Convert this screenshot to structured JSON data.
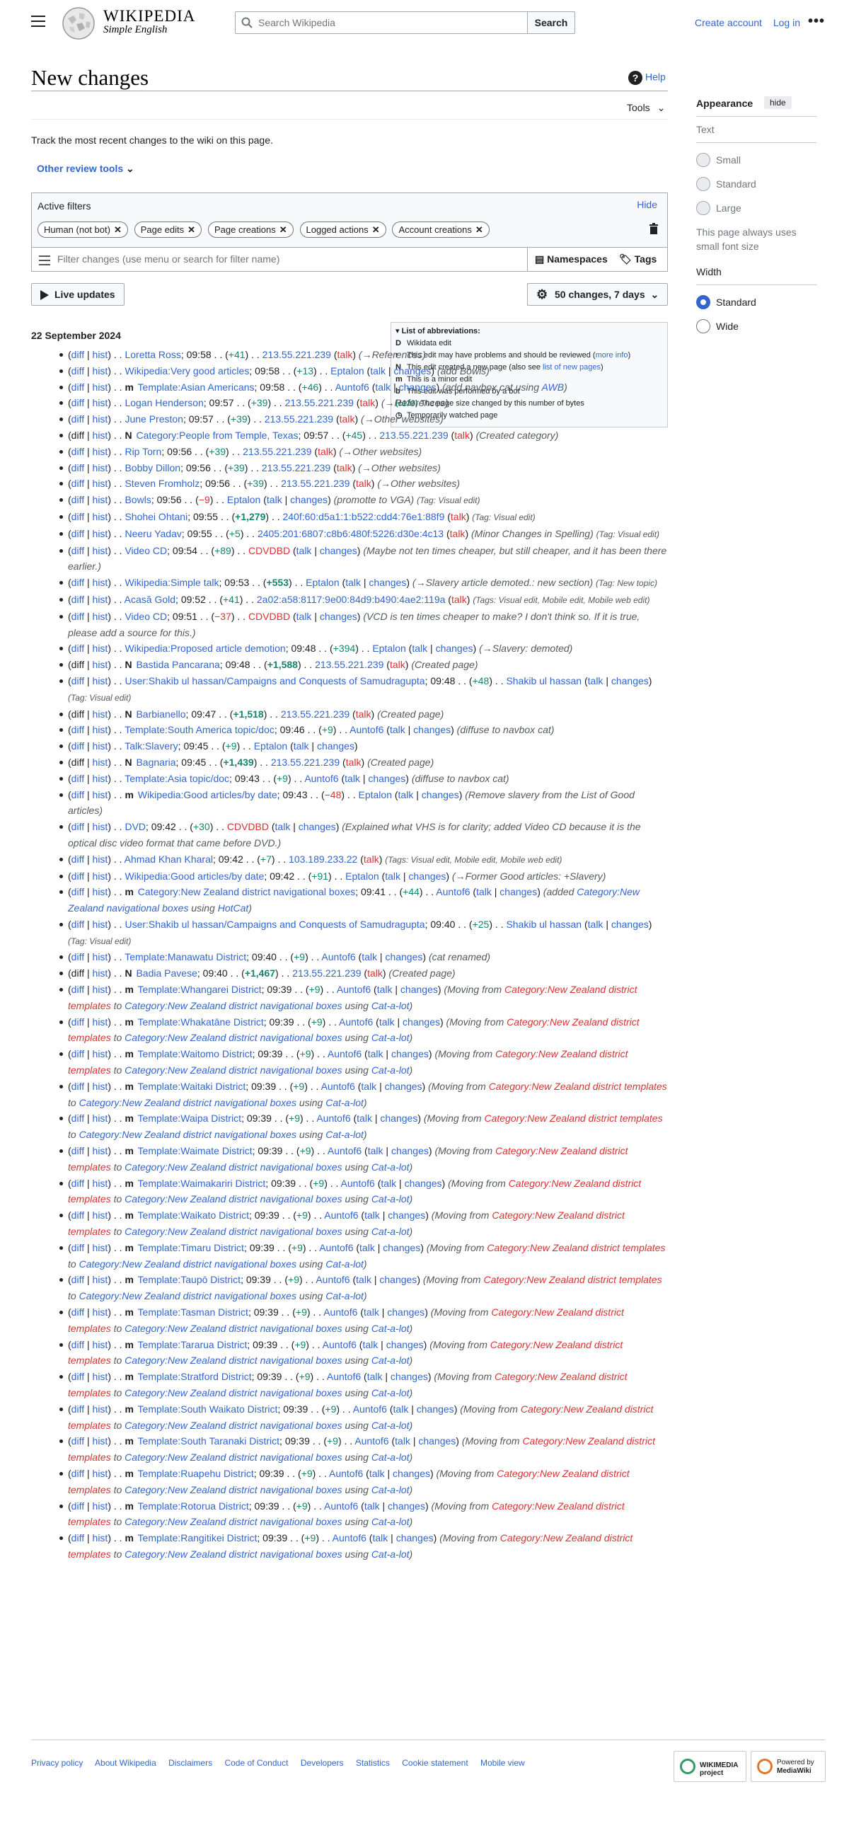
{
  "header": {
    "wordmark_line1": "WIKIPEDIA",
    "wordmark_line2": "Simple English",
    "search_placeholder": "Search Wikipedia",
    "search_button": "Search",
    "create_account": "Create account",
    "log_in": "Log in",
    "more": "•••"
  },
  "page": {
    "title": "New changes",
    "help": "Help",
    "tools": "Tools",
    "intro": "Track the most recent changes to the wiki on this page.",
    "other_review_tools": "Other review tools"
  },
  "filters": {
    "active_label": "Active filters",
    "hide": "Hide",
    "chips": [
      "Human (not bot)",
      "Page edits",
      "Page creations",
      "Logged actions",
      "Account creations"
    ],
    "input_placeholder": "Filter changes (use menu or search for filter name)",
    "namespaces": "Namespaces",
    "tags": "Tags"
  },
  "controls": {
    "live_updates": "Live updates",
    "changes_range": "50 changes, 7 days"
  },
  "legend": {
    "title": "List of abbreviations:",
    "items": [
      {
        "key": "D",
        "text": "Wikidata edit"
      },
      {
        "key": "r",
        "text": "This edit may have problems and should be reviewed",
        "link": "more info"
      },
      {
        "key": "N",
        "text": "This edit created a new page (also see",
        "link": "list of new pages",
        "after": ")"
      },
      {
        "key": "m",
        "text": "This is a minor edit"
      },
      {
        "key": "b",
        "text": "This edit was performed by a bot"
      },
      {
        "key": "(±123)",
        "text": "The page size changed by this number of bytes"
      },
      {
        "key": "◷",
        "text": "Temporarily watched page"
      }
    ]
  },
  "date_heading": "22 September 2024",
  "changes": [
    {
      "diff": true,
      "flag": "",
      "title": "Loretta Ross",
      "time": "09:58",
      "size": "+41",
      "user": "213.55.221.239",
      "user_red": false,
      "ip": true,
      "comment": "(→References)"
    },
    {
      "diff": true,
      "flag": "",
      "title": "Wikipedia:Very good articles",
      "time": "09:58",
      "size": "+13",
      "user": "Eptalon",
      "ip": false,
      "comment": "(add Bowls)"
    },
    {
      "diff": true,
      "flag": "m",
      "title": "Template:Asian Americans",
      "time": "09:58",
      "size": "+46",
      "user": "Auntof6",
      "ip": false,
      "comment": "(add navbox cat using ",
      "comment_link": "AWB",
      "comment_after": ")"
    },
    {
      "diff": true,
      "flag": "",
      "title": "Logan Henderson",
      "time": "09:57",
      "size": "+39",
      "user": "213.55.221.239",
      "ip": true,
      "comment": "(→References)"
    },
    {
      "diff": true,
      "flag": "",
      "title": "June Preston",
      "time": "09:57",
      "size": "+39",
      "user": "213.55.221.239",
      "ip": true,
      "comment": "(→Other websites)"
    },
    {
      "diff": false,
      "flag": "N",
      "title": "Category:People from Temple, Texas",
      "time": "09:57",
      "size": "+45",
      "user": "213.55.221.239",
      "ip": true,
      "comment": "(Created category)"
    },
    {
      "diff": true,
      "flag": "",
      "title": "Rip Torn",
      "time": "09:56",
      "size": "+39",
      "user": "213.55.221.239",
      "ip": true,
      "comment": "(→Other websites)"
    },
    {
      "diff": true,
      "flag": "",
      "title": "Bobby Dillon",
      "time": "09:56",
      "size": "+39",
      "user": "213.55.221.239",
      "ip": true,
      "comment": "(→Other websites)"
    },
    {
      "diff": true,
      "flag": "",
      "title": "Steven Fromholz",
      "time": "09:56",
      "size": "+39",
      "user": "213.55.221.239",
      "ip": true,
      "comment": "(→Other websites)"
    },
    {
      "diff": true,
      "flag": "",
      "title": "Bowls",
      "time": "09:56",
      "size": "−9",
      "neg": true,
      "user": "Eptalon",
      "ip": false,
      "comment": "(promotte to VGA)",
      "tag": "(Tag: Visual edit)"
    },
    {
      "diff": true,
      "flag": "",
      "title": "Shohei Ohtani",
      "time": "09:55",
      "size": "+1,279",
      "big": true,
      "user": "240f:60:d5a1:1:b522:cdd4:76e1:88f9",
      "ip": true,
      "comment": "",
      "tag": "(Tag: Visual edit)"
    },
    {
      "diff": true,
      "flag": "",
      "title": "Neeru Yadav",
      "time": "09:55",
      "size": "+5",
      "user": "2405:201:6807:c8b6:480f:5226:d30e:4c13",
      "ip": true,
      "comment": "(Minor Changes in Spelling)",
      "tag": "(Tag: Visual edit)"
    },
    {
      "diff": true,
      "flag": "",
      "title": "Video CD",
      "time": "09:54",
      "size": "+89",
      "user": "CDVDBD",
      "user_red": true,
      "ip": false,
      "comment": "(Maybe not ten times cheaper, but still cheaper, and it has been there earlier.)"
    },
    {
      "diff": true,
      "flag": "",
      "title": "Wikipedia:Simple talk",
      "time": "09:53",
      "size": "+553",
      "big": true,
      "user": "Eptalon",
      "ip": false,
      "comment": "(→Slavery article demoted.: new section)",
      "tag": "(Tag: New topic)"
    },
    {
      "diff": true,
      "flag": "",
      "title": "Acasă Gold",
      "time": "09:52",
      "size": "+41",
      "user": "2a02:a58:8117:9e00:84d9:b490:4ae2:119a",
      "ip": true,
      "comment": "",
      "tag": "(Tags: Visual edit, Mobile edit, Mobile web edit)"
    },
    {
      "diff": true,
      "flag": "",
      "title": "Video CD",
      "time": "09:51",
      "size": "−37",
      "neg": true,
      "user": "CDVDBD",
      "user_red": true,
      "ip": false,
      "comment": "(VCD is ten times cheaper to make? I don't think so. If it is true, please add a source for this.)"
    },
    {
      "diff": true,
      "flag": "",
      "title": "Wikipedia:Proposed article demotion",
      "time": "09:48",
      "size": "+394",
      "user": "Eptalon",
      "ip": false,
      "comment": "(→Slavery: demoted)"
    },
    {
      "diff": false,
      "flag": "N",
      "title": "Bastida Pancarana",
      "time": "09:48",
      "size": "+1,588",
      "big": true,
      "user": "213.55.221.239",
      "ip": true,
      "comment": "(Created page)"
    },
    {
      "diff": true,
      "flag": "",
      "title": "User:Shakib ul hassan/Campaigns and Conquests of Samudragupta",
      "time": "09:48",
      "size": "+48",
      "user": "Shakib ul hassan",
      "ip": false,
      "comment": "",
      "tag": "(Tag: Visual edit)"
    },
    {
      "diff": false,
      "flag": "N",
      "title": "Barbianello",
      "time": "09:47",
      "size": "+1,518",
      "big": true,
      "user": "213.55.221.239",
      "ip": true,
      "comment": "(Created page)"
    },
    {
      "diff": true,
      "flag": "",
      "title": "Template:South America topic/doc",
      "time": "09:46",
      "size": "+9",
      "user": "Auntof6",
      "ip": false,
      "comment": "(diffuse to navbox cat)"
    },
    {
      "diff": true,
      "flag": "",
      "title": "Talk:Slavery",
      "time": "09:45",
      "size": "+9",
      "user": "Eptalon",
      "ip": false,
      "comment": ""
    },
    {
      "diff": false,
      "flag": "N",
      "title": "Bagnaria",
      "time": "09:45",
      "size": "+1,439",
      "big": true,
      "user": "213.55.221.239",
      "ip": true,
      "comment": "(Created page)"
    },
    {
      "diff": true,
      "flag": "",
      "title": "Template:Asia topic/doc",
      "time": "09:43",
      "size": "+9",
      "user": "Auntof6",
      "ip": false,
      "comment": "(diffuse to navbox cat)"
    },
    {
      "diff": true,
      "flag": "m",
      "title": "Wikipedia:Good articles/by date",
      "time": "09:43",
      "size": "−48",
      "neg": true,
      "user": "Eptalon",
      "ip": false,
      "comment": "(Remove slavery from the List of Good articles)"
    },
    {
      "diff": true,
      "flag": "",
      "title": "DVD",
      "time": "09:42",
      "size": "+30",
      "user": "CDVDBD",
      "user_red": true,
      "ip": false,
      "comment": "(Explained what VHS is for clarity; added Video CD because it is the optical disc video format that came before DVD.)"
    },
    {
      "diff": true,
      "flag": "",
      "title": "Ahmad Khan Kharal",
      "time": "09:42",
      "size": "+7",
      "user": "103.189.233.22",
      "ip": true,
      "comment": "",
      "tag": "(Tags: Visual edit, Mobile edit, Mobile web edit)"
    },
    {
      "diff": true,
      "flag": "",
      "title": "Wikipedia:Good articles/by date",
      "time": "09:42",
      "size": "+91",
      "user": "Eptalon",
      "ip": false,
      "comment": "(→Former Good articles: +Slavery)"
    },
    {
      "diff": true,
      "flag": "m",
      "title": "Category:New Zealand district navigational boxes",
      "time": "09:41",
      "size": "+44",
      "user": "Auntof6",
      "ip": false,
      "comment": "(added ",
      "comment_link": "Category:New Zealand navigational boxes",
      "comment_after": " using ",
      "comment_link2": "HotCat",
      "comment_after2": ")"
    },
    {
      "diff": true,
      "flag": "",
      "title": "User:Shakib ul hassan/Campaigns and Conquests of Samudragupta",
      "time": "09:40",
      "size": "+25",
      "user": "Shakib ul hassan",
      "ip": false,
      "comment": "",
      "tag": "(Tag: Visual edit)"
    },
    {
      "diff": true,
      "flag": "",
      "title": "Template:Manawatu District",
      "time": "09:40",
      "size": "+9",
      "user": "Auntof6",
      "ip": false,
      "comment": "(cat renamed)"
    },
    {
      "diff": false,
      "flag": "N",
      "title": "Badia Pavese",
      "time": "09:40",
      "size": "+1,467",
      "big": true,
      "user": "213.55.221.239",
      "ip": true,
      "comment": "(Created page)"
    },
    {
      "diff": true,
      "flag": "m",
      "title": "Template:Whangarei District",
      "time": "09:39",
      "size": "+9",
      "user": "Auntof6",
      "ip": false,
      "nz": true
    },
    {
      "diff": true,
      "flag": "m",
      "title": "Template:Whakatāne District",
      "time": "09:39",
      "size": "+9",
      "user": "Auntof6",
      "ip": false,
      "nz": true
    },
    {
      "diff": true,
      "flag": "m",
      "title": "Template:Waitomo District",
      "time": "09:39",
      "size": "+9",
      "user": "Auntof6",
      "ip": false,
      "nz": true
    },
    {
      "diff": true,
      "flag": "m",
      "title": "Template:Waitaki District",
      "time": "09:39",
      "size": "+9",
      "user": "Auntof6",
      "ip": false,
      "nz": true
    },
    {
      "diff": true,
      "flag": "m",
      "title": "Template:Waipa District",
      "time": "09:39",
      "size": "+9",
      "user": "Auntof6",
      "ip": false,
      "nz": true
    },
    {
      "diff": true,
      "flag": "m",
      "title": "Template:Waimate District",
      "time": "09:39",
      "size": "+9",
      "user": "Auntof6",
      "ip": false,
      "nz": true
    },
    {
      "diff": true,
      "flag": "m",
      "title": "Template:Waimakariri District",
      "time": "09:39",
      "size": "+9",
      "user": "Auntof6",
      "ip": false,
      "nz": true
    },
    {
      "diff": true,
      "flag": "m",
      "title": "Template:Waikato District",
      "time": "09:39",
      "size": "+9",
      "user": "Auntof6",
      "ip": false,
      "nz": true
    },
    {
      "diff": true,
      "flag": "m",
      "title": "Template:Timaru District",
      "time": "09:39",
      "size": "+9",
      "user": "Auntof6",
      "ip": false,
      "nz": true
    },
    {
      "diff": true,
      "flag": "m",
      "title": "Template:Taupō District",
      "time": "09:39",
      "size": "+9",
      "user": "Auntof6",
      "ip": false,
      "nz": true
    },
    {
      "diff": true,
      "flag": "m",
      "title": "Template:Tasman District",
      "time": "09:39",
      "size": "+9",
      "user": "Auntof6",
      "ip": false,
      "nz": true
    },
    {
      "diff": true,
      "flag": "m",
      "title": "Template:Tararua District",
      "time": "09:39",
      "size": "+9",
      "user": "Auntof6",
      "ip": false,
      "nz": true
    },
    {
      "diff": true,
      "flag": "m",
      "title": "Template:Stratford District",
      "time": "09:39",
      "size": "+9",
      "user": "Auntof6",
      "ip": false,
      "nz": true
    },
    {
      "diff": true,
      "flag": "m",
      "title": "Template:South Waikato District",
      "time": "09:39",
      "size": "+9",
      "user": "Auntof6",
      "ip": false,
      "nz": true
    },
    {
      "diff": true,
      "flag": "m",
      "title": "Template:South Taranaki District",
      "time": "09:39",
      "size": "+9",
      "user": "Auntof6",
      "ip": false,
      "nz": true
    },
    {
      "diff": true,
      "flag": "m",
      "title": "Template:Ruapehu District",
      "time": "09:39",
      "size": "+9",
      "user": "Auntof6",
      "ip": false,
      "nz": true
    },
    {
      "diff": true,
      "flag": "m",
      "title": "Template:Rotorua District",
      "time": "09:39",
      "size": "+9",
      "user": "Auntof6",
      "ip": false,
      "nz": true
    },
    {
      "diff": true,
      "flag": "m",
      "title": "Template:Rangitikei District",
      "time": "09:39",
      "size": "+9",
      "user": "Auntof6",
      "ip": false,
      "nz": true
    }
  ],
  "strings": {
    "diff": "diff",
    "hist": "hist",
    "talk": "talk",
    "changes": "changes",
    "nz_moving": "(Moving from ",
    "nz_from": "Category:New Zealand district templates",
    "nz_to_word": " to ",
    "nz_to": "Category:New Zealand district navigational boxes",
    "nz_using": " using ",
    "nz_tool": "Cat-a-lot",
    "nz_close": ")"
  },
  "sidebar": {
    "title": "Appearance",
    "hide": "hide",
    "text_label": "Text",
    "text_options": [
      "Small",
      "Standard",
      "Large"
    ],
    "text_note": "This page always uses small font size",
    "width_label": "Width",
    "width_options": [
      "Standard",
      "Wide"
    ],
    "width_selected": "Standard"
  },
  "footer": {
    "links": [
      "Privacy policy",
      "About Wikipedia",
      "Disclaimers",
      "Code of Conduct",
      "Developers",
      "Statistics",
      "Cookie statement",
      "Mobile view"
    ],
    "badge1": "WIKIMEDIA project",
    "badge2_line1": "Powered by",
    "badge2_line2": "MediaWiki"
  },
  "colors": {
    "link": "#3366cc",
    "redlink": "#d73333",
    "positive": "#14866d",
    "negative": "#dd3333"
  }
}
